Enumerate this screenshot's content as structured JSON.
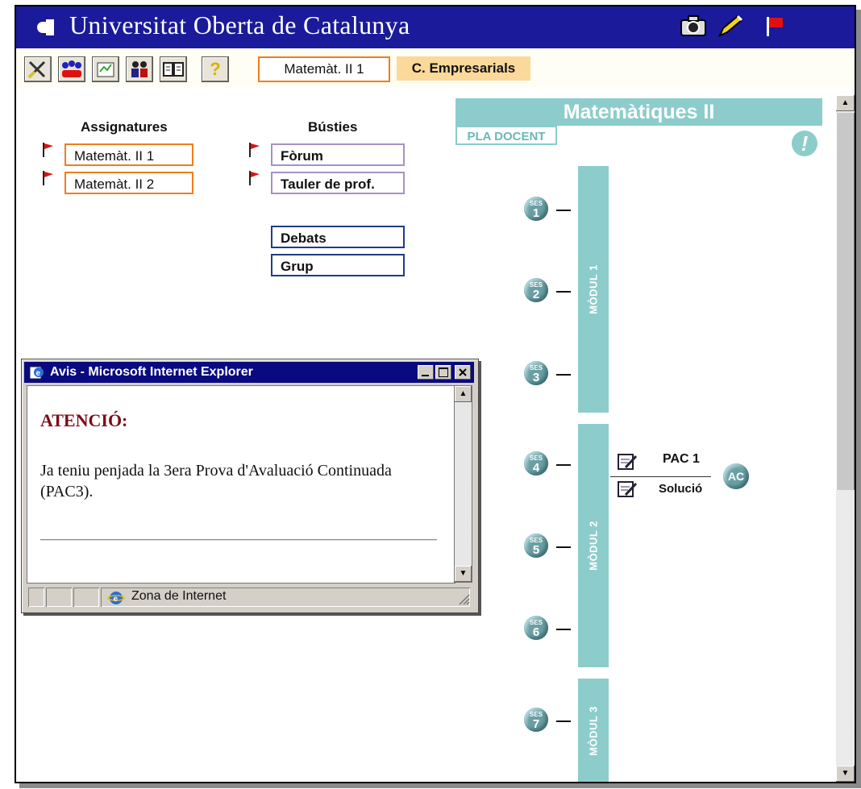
{
  "header": {
    "title": "Universitat Oberta de Catalunya",
    "icons": [
      "camera-icon",
      "pen-icon",
      "flag-icon"
    ]
  },
  "toolbar": {
    "buttons": [
      "tools-icon",
      "group-icon",
      "activities-icon",
      "users-icon",
      "book-icon",
      "help-icon"
    ],
    "help_label": "?",
    "current_subject": "Matemàt. II 1",
    "degree": "C. Empresarials"
  },
  "assignatures": {
    "heading": "Assignatures",
    "items": [
      "Matemàt. II 1",
      "Matemàt. II 2"
    ]
  },
  "busties": {
    "heading": "Bústies",
    "items": [
      "Fòrum",
      "Tauler de prof."
    ],
    "extra": [
      "Debats",
      "Grup"
    ]
  },
  "plan": {
    "title": "Matemàtiques II",
    "pla_docent": "PLA DOCENT",
    "alert": "!",
    "modules": [
      "MÒDUL 1",
      "MÒDUL 2",
      "MÒDUL 3"
    ],
    "ses_label": "SES",
    "sessions": [
      "1",
      "2",
      "3",
      "4",
      "5",
      "6",
      "7"
    ],
    "pac_label": "PAC 1",
    "solution_label": "Solució",
    "ac_label": "AC"
  },
  "popup": {
    "title": "Avis - Microsoft Internet Explorer",
    "heading": "ATENCIÓ:",
    "message": "Ja teniu penjada la 3era Prova d'Avaluació Continuada (PAC3).",
    "status": "Zona de Internet"
  },
  "colors": {
    "header_bg": "#1a1a9a",
    "teal": "#8ccdcb",
    "orange": "#f07d1c",
    "purple": "#a791c2",
    "navy": "#1f3c86",
    "degree_bg": "#fbd99a",
    "alert_red": "#7a0e17"
  }
}
